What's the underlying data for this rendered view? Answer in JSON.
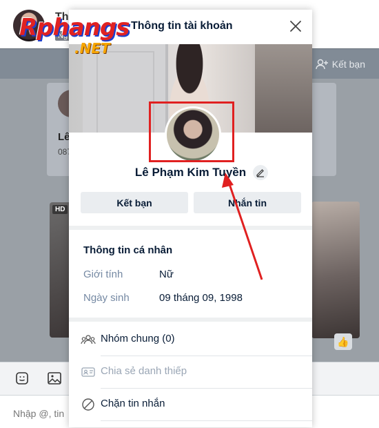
{
  "background": {
    "contact_name": "Th",
    "contact_sub": "Ng",
    "add_friend_label": "Kết bạn",
    "card_name": "Lê",
    "card_phone": "087",
    "hd_badge": "HD",
    "input_placeholder": "Nhập @, tin"
  },
  "watermark": {
    "main": "Rphangs",
    "suffix": ".NET"
  },
  "modal": {
    "title": "Thông tin tài khoản",
    "name": "Lê Phạm Kim Tuyền",
    "add_friend_button": "Kết bạn",
    "message_button": "Nhắn tin",
    "personal_info": {
      "title": "Thông tin cá nhân",
      "gender_label": "Giới tính",
      "gender_value": "Nữ",
      "birthday_label": "Ngày sinh",
      "birthday_value": "09 tháng 09, 1998"
    },
    "actions": [
      {
        "label": "Nhóm chung (0)",
        "icon": "group-icon",
        "enabled": true
      },
      {
        "label": "Chia sẻ danh thiếp",
        "icon": "contact-card-icon",
        "enabled": false
      },
      {
        "label": "Chặn tin nhắn",
        "icon": "block-icon",
        "enabled": true
      }
    ]
  },
  "colors": {
    "highlight": "#e02020",
    "text_primary": "#081c36",
    "text_secondary": "#7589a3",
    "button_bg": "#eaedf0"
  }
}
